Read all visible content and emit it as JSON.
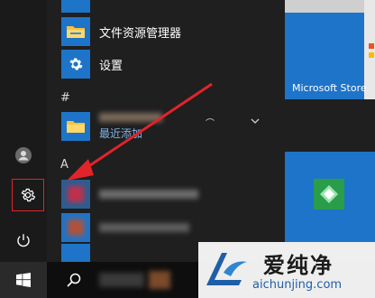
{
  "apps": {
    "explorer_label": "文件资源管理器",
    "settings_label": "设置",
    "section_hash": "#",
    "recent_sub": "最近添加",
    "section_a": "A",
    "expand_icon": "chevron-down-icon"
  },
  "tiles": {
    "store_label": "Microsoft Store"
  },
  "watermark": {
    "brand_cn": "爱纯净",
    "url": "aichunjing.com"
  },
  "colors": {
    "accent": "#1e74c8",
    "highlight": "#e0242a",
    "annotation_arrow": "#e0242a"
  }
}
